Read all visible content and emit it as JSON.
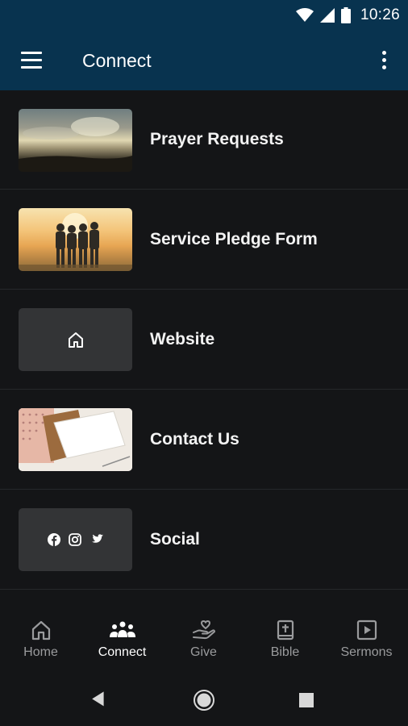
{
  "status": {
    "time": "10:26"
  },
  "app": {
    "title": "Connect"
  },
  "items": [
    {
      "label": "Prayer Requests"
    },
    {
      "label": "Service Pledge Form"
    },
    {
      "label": "Website"
    },
    {
      "label": "Contact Us"
    },
    {
      "label": "Social"
    }
  ],
  "nav": [
    {
      "label": "Home",
      "icon": "home-icon"
    },
    {
      "label": "Connect",
      "icon": "people-icon",
      "active": true
    },
    {
      "label": "Give",
      "icon": "give-icon"
    },
    {
      "label": "Bible",
      "icon": "bible-icon"
    },
    {
      "label": "Sermons",
      "icon": "play-icon"
    }
  ],
  "colors": {
    "appbar": "#08334f",
    "background": "#141517",
    "inactive": "#9a9b9d"
  }
}
